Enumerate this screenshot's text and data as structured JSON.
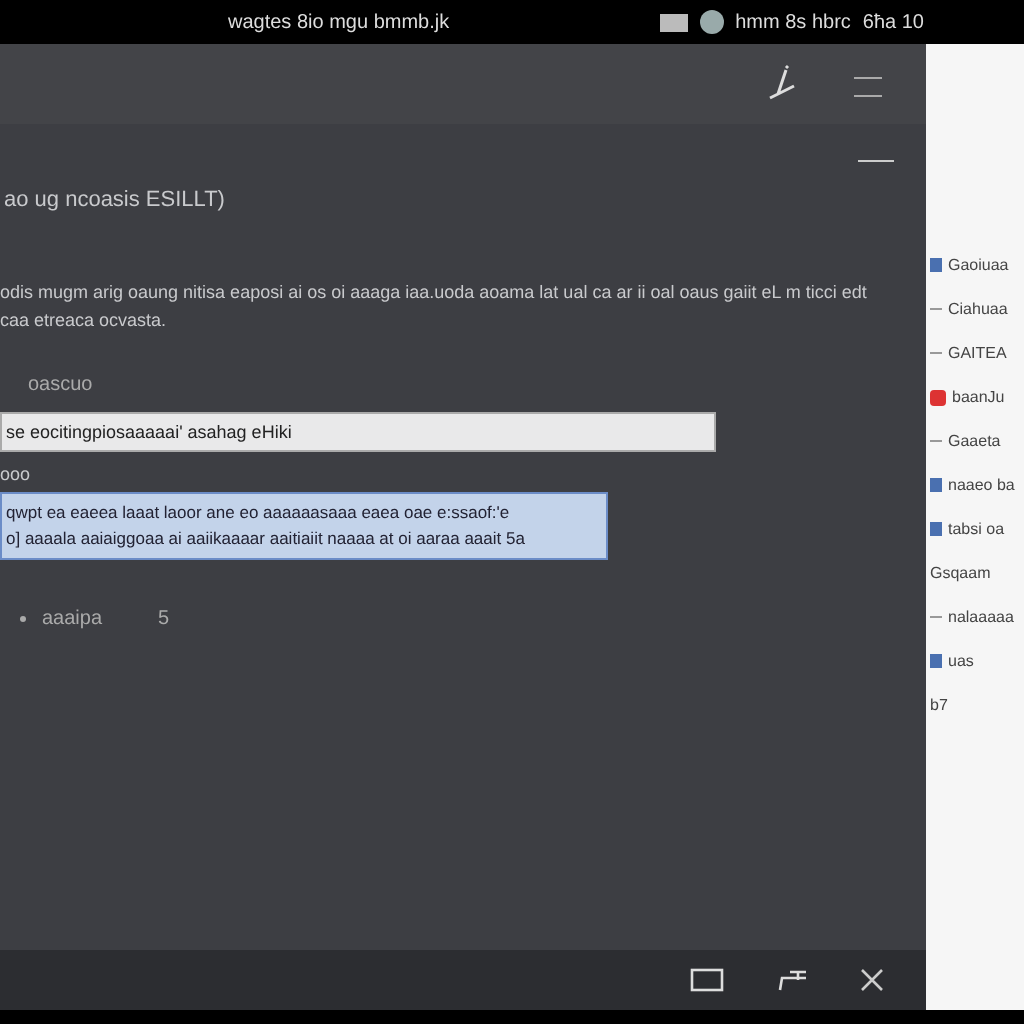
{
  "status_bar": {
    "title": "wagtes 8io mgu bmmb.jk",
    "right_text": "hmm 8s hbrc",
    "time": "6ħa 10"
  },
  "dialog": {
    "heading": "ao ug ncoasis ESILLT)",
    "description": "odis mugm arig oaung nitisa eaposi ai os oi aaaga iaa.uoda aoama lat ual ca ar ii oal oaus gaiit eL m ticci edt caa etreaca ocvasta.",
    "field_label": "oascuo",
    "field_value": "se eocitingpiosaaaaai' asahag eHiki",
    "note_label": "ooo",
    "note_lines": [
      "qwpt ea eaeea laaat laoor ane eo aaaaaasaaa eaea oae e:ssaof:'e",
      "o] aaaala aaiaiggoaa ai aaiikaaaar aaitiaiit naaaa at oi aaraa aaait 5a"
    ],
    "note_selected": true,
    "bullet_text": "aaaipa",
    "bullet_mark": "5"
  },
  "side_panel": {
    "items": [
      {
        "label": "Gaoiuaa",
        "kind": "folder"
      },
      {
        "label": "Ciahuaa",
        "kind": "plain"
      },
      {
        "label": "GAITEA",
        "kind": "plain"
      },
      {
        "label": "baanJu",
        "kind": "app"
      },
      {
        "label": "Gaaeta",
        "kind": "plain"
      },
      {
        "label": "naaeo ba",
        "kind": "folder"
      },
      {
        "label": "tabsi oa",
        "kind": "folder"
      },
      {
        "label": "Gsqaam",
        "kind": "text"
      },
      {
        "label": "nalaaaaa",
        "kind": "plain"
      },
      {
        "label": "uas",
        "kind": "folder"
      },
      {
        "label": "b7",
        "kind": "text"
      }
    ]
  }
}
